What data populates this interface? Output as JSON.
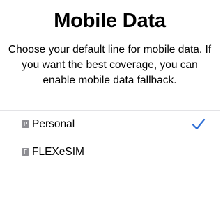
{
  "page": {
    "title": "Mobile Data",
    "description": "Choose your default line for mobile data. If you want the best coverage, you can enable mobile data fallback."
  },
  "lines": [
    {
      "badge": "P",
      "label": "Personal",
      "selected": true
    },
    {
      "badge": "F",
      "label": "FLEXeSIM",
      "selected": false
    }
  ],
  "colors": {
    "accent": "#2f6fd6",
    "badge": "#8e8e93",
    "separator": "#e3e3e6"
  },
  "icons": {
    "selected": "checkmark-icon"
  }
}
